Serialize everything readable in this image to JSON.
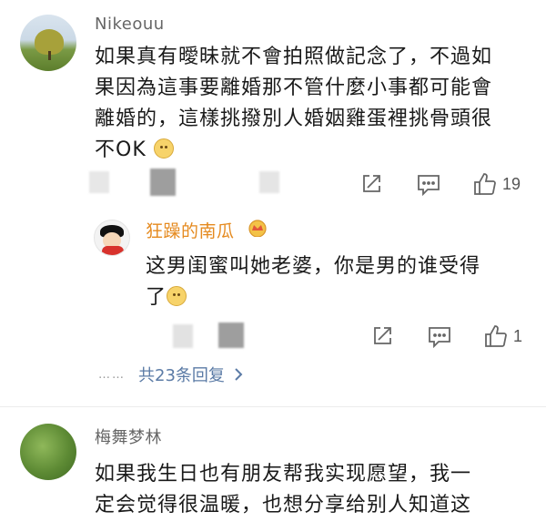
{
  "comments": [
    {
      "username": "Nikeouu",
      "text_line1": "如果真有曖昧就不會拍照做記念了，不過如",
      "text_line2": "果因為這事要離婚那不管什麼小事都可能會",
      "text_line3": "離婚的，這樣挑撥別人婚姻雞蛋裡挑骨頭很",
      "text_line4": "不OK",
      "like_count": "19"
    },
    {
      "username": "梅舞梦林",
      "text_line1": "如果我生日也有朋友帮我实现愿望，我一",
      "text_line2": "定会觉得很温暖，也想分享给别人知道这"
    }
  ],
  "reply": {
    "username": "狂躁的南瓜",
    "text_line1": "这男闺蜜叫她老婆，你是男的谁受得",
    "text_line2": "了",
    "like_count": "1"
  },
  "more_replies": {
    "dots": "……",
    "label": "共23条回复"
  },
  "icons": [
    "share-icon",
    "comment-icon",
    "like-icon",
    "chevron-right-icon",
    "vip-crown-icon",
    "emoji-icon"
  ],
  "colors": {
    "reply_username": "#e58a1f",
    "link": "#5b7ba6"
  }
}
